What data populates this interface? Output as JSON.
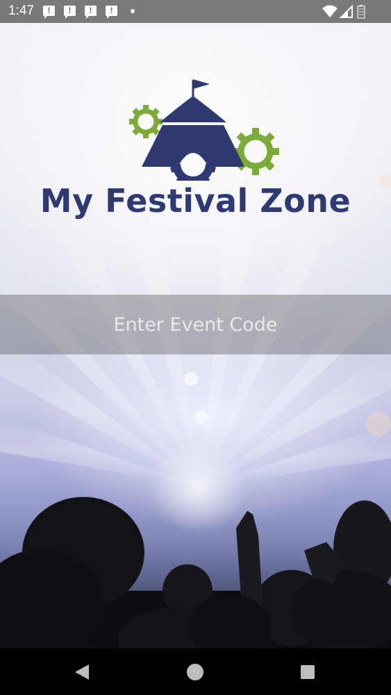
{
  "status_bar": {
    "time": "1:47",
    "notification_icon_glyph": "!",
    "notification_count": 4,
    "icons": [
      "alert-notification-icon",
      "alert-notification-icon",
      "alert-notification-icon",
      "alert-notification-icon",
      "more-notifications-dot-icon",
      "wifi-icon",
      "cell-signal-icon",
      "battery-icon"
    ]
  },
  "brand": {
    "title": "My Festival Zone",
    "logo_icon": "festival-tent-gears-logo",
    "primary_color": "#2f3a73",
    "accent_color": "#7cab3a"
  },
  "event_code": {
    "value": "",
    "placeholder": "Enter Event Code"
  },
  "nav_bar": {
    "back_icon": "back-triangle-icon",
    "home_icon": "home-circle-icon",
    "recents_icon": "recents-square-icon"
  }
}
